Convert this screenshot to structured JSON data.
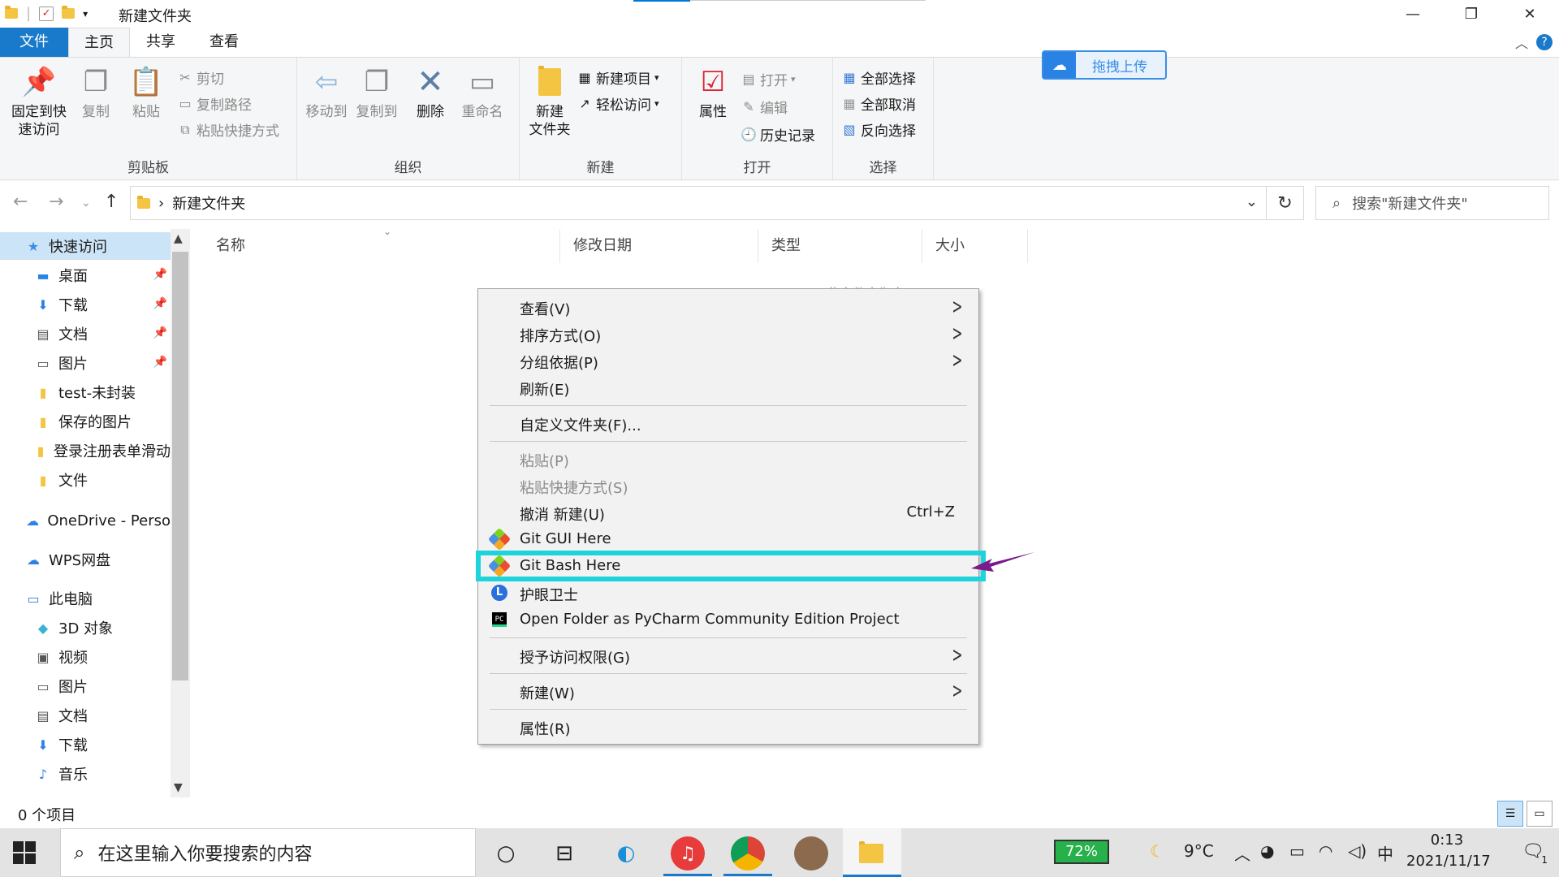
{
  "window": {
    "title": "新建文件夹",
    "minimize": "—",
    "restore": "❐",
    "close": "✕"
  },
  "ribbon_tabs": [
    "文件",
    "主页",
    "共享",
    "查看"
  ],
  "ribbon": {
    "clipboard": {
      "pin_label_1": "固定到快",
      "pin_label_2": "速访问",
      "copy": "复制",
      "paste": "粘贴",
      "cut": "剪切",
      "copy_path": "复制路径",
      "paste_shortcut": "粘贴快捷方式",
      "group": "剪贴板"
    },
    "organize": {
      "move_to": "移动到",
      "copy_to": "复制到",
      "delete": "删除",
      "rename": "重命名",
      "group": "组织"
    },
    "new": {
      "new_folder_1": "新建",
      "new_folder_2": "文件夹",
      "new_item": "新建项目",
      "easy_access": "轻松访问",
      "group": "新建"
    },
    "open": {
      "properties": "属性",
      "open": "打开",
      "edit": "编辑",
      "history": "历史记录",
      "group": "打开"
    },
    "select": {
      "select_all": "全部选择",
      "select_none": "全部取消",
      "invert": "反向选择",
      "group": "选择"
    }
  },
  "upload_button": "拖拽上传",
  "address": {
    "path": "新建文件夹",
    "search_placeholder": "搜索\"新建文件夹\""
  },
  "nav_pane": {
    "items": [
      {
        "label": "快速访问",
        "icon": "star-icon",
        "selected": true
      },
      {
        "label": "桌面",
        "icon": "desktop-icon",
        "pinned": true
      },
      {
        "label": "下载",
        "icon": "download-icon",
        "pinned": true
      },
      {
        "label": "文档",
        "icon": "document-icon",
        "pinned": true
      },
      {
        "label": "图片",
        "icon": "picture-icon",
        "pinned": true
      },
      {
        "label": "test-未封装",
        "icon": "folder-icon"
      },
      {
        "label": "保存的图片",
        "icon": "folder-icon"
      },
      {
        "label": "登录注册表单滑动",
        "icon": "folder-icon"
      },
      {
        "label": "文件",
        "icon": "folder-icon"
      },
      {
        "label": "OneDrive - Perso",
        "icon": "cloud-icon"
      },
      {
        "label": "WPS网盘",
        "icon": "cloud-icon"
      },
      {
        "label": "此电脑",
        "icon": "computer-icon"
      },
      {
        "label": "3D 对象",
        "icon": "cube-icon"
      },
      {
        "label": "视频",
        "icon": "video-icon"
      },
      {
        "label": "图片",
        "icon": "picture-icon"
      },
      {
        "label": "文档",
        "icon": "document-icon"
      },
      {
        "label": "下载",
        "icon": "download-icon"
      },
      {
        "label": "音乐",
        "icon": "music-icon"
      }
    ]
  },
  "columns": [
    "名称",
    "修改日期",
    "类型",
    "大小"
  ],
  "empty_message": "此文件夹为空",
  "context_menu": {
    "items": [
      {
        "label": "查看(V)",
        "submenu": true
      },
      {
        "label": "排序方式(O)",
        "submenu": true
      },
      {
        "label": "分组依据(P)",
        "submenu": true
      },
      {
        "label": "刷新(E)"
      },
      {
        "label": "自定义文件夹(F)..."
      },
      {
        "label": "粘贴(P)",
        "disabled": true
      },
      {
        "label": "粘贴快捷方式(S)",
        "disabled": true
      },
      {
        "label": "撤消 新建(U)",
        "shortcut": "Ctrl+Z"
      },
      {
        "label": "Git GUI Here",
        "icon": "git-icon"
      },
      {
        "label": "Git Bash Here",
        "icon": "git-icon",
        "highlighted": true
      },
      {
        "label": "护眼卫士",
        "icon": "eye-guard-icon"
      },
      {
        "label": "Open Folder as PyCharm Community Edition Project",
        "icon": "pycharm-icon"
      },
      {
        "label": "授予访问权限(G)",
        "submenu": true
      },
      {
        "label": "新建(W)",
        "submenu": true
      },
      {
        "label": "属性(R)"
      }
    ]
  },
  "status_bar": {
    "count": "0 个项目"
  },
  "taskbar": {
    "search_placeholder": "在这里输入你要搜索的内容",
    "battery": "72%",
    "temperature": "9°C",
    "ime": "中",
    "time": "0:13",
    "date": "2021/11/17",
    "notifications": "1"
  },
  "colors": {
    "accent": "#1979ca",
    "highlight_box": "#1dd3dc",
    "arrow": "#7a1a8c",
    "battery": "#27b14b"
  }
}
